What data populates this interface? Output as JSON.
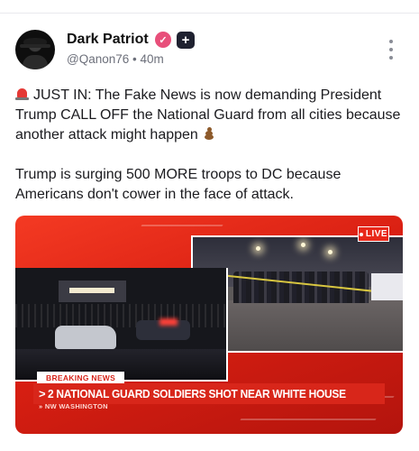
{
  "author": {
    "name": "Dark Patriot",
    "handle": "@Qanon76",
    "separator": "•",
    "time": "40m",
    "verified_icon": "heart-check-icon",
    "badge_icon": "plus-badge-icon"
  },
  "post": {
    "paragraph1": "JUST IN: The Fake News is now demanding President Trump CALL OFF the National Guard from all cities because another attack might happen",
    "paragraph2": "Trump is surging 500 MORE troops to DC because Americans don't cower in the face of attack.",
    "leading_emoji": "police-siren-icon",
    "trailing_emoji": "pile-of-poo-icon"
  },
  "media": {
    "live_label": "LIVE",
    "breaking_label": "BREAKING NEWS",
    "headline_arrow": ">",
    "headline": "2 NATIONAL GUARD SOLDIERS SHOT NEAR WHITE HOUSE",
    "location": "NW WASHINGTON"
  },
  "colors": {
    "verified": "#e84f7a",
    "badge": "#1f2130",
    "news_red": "#d8261a"
  }
}
